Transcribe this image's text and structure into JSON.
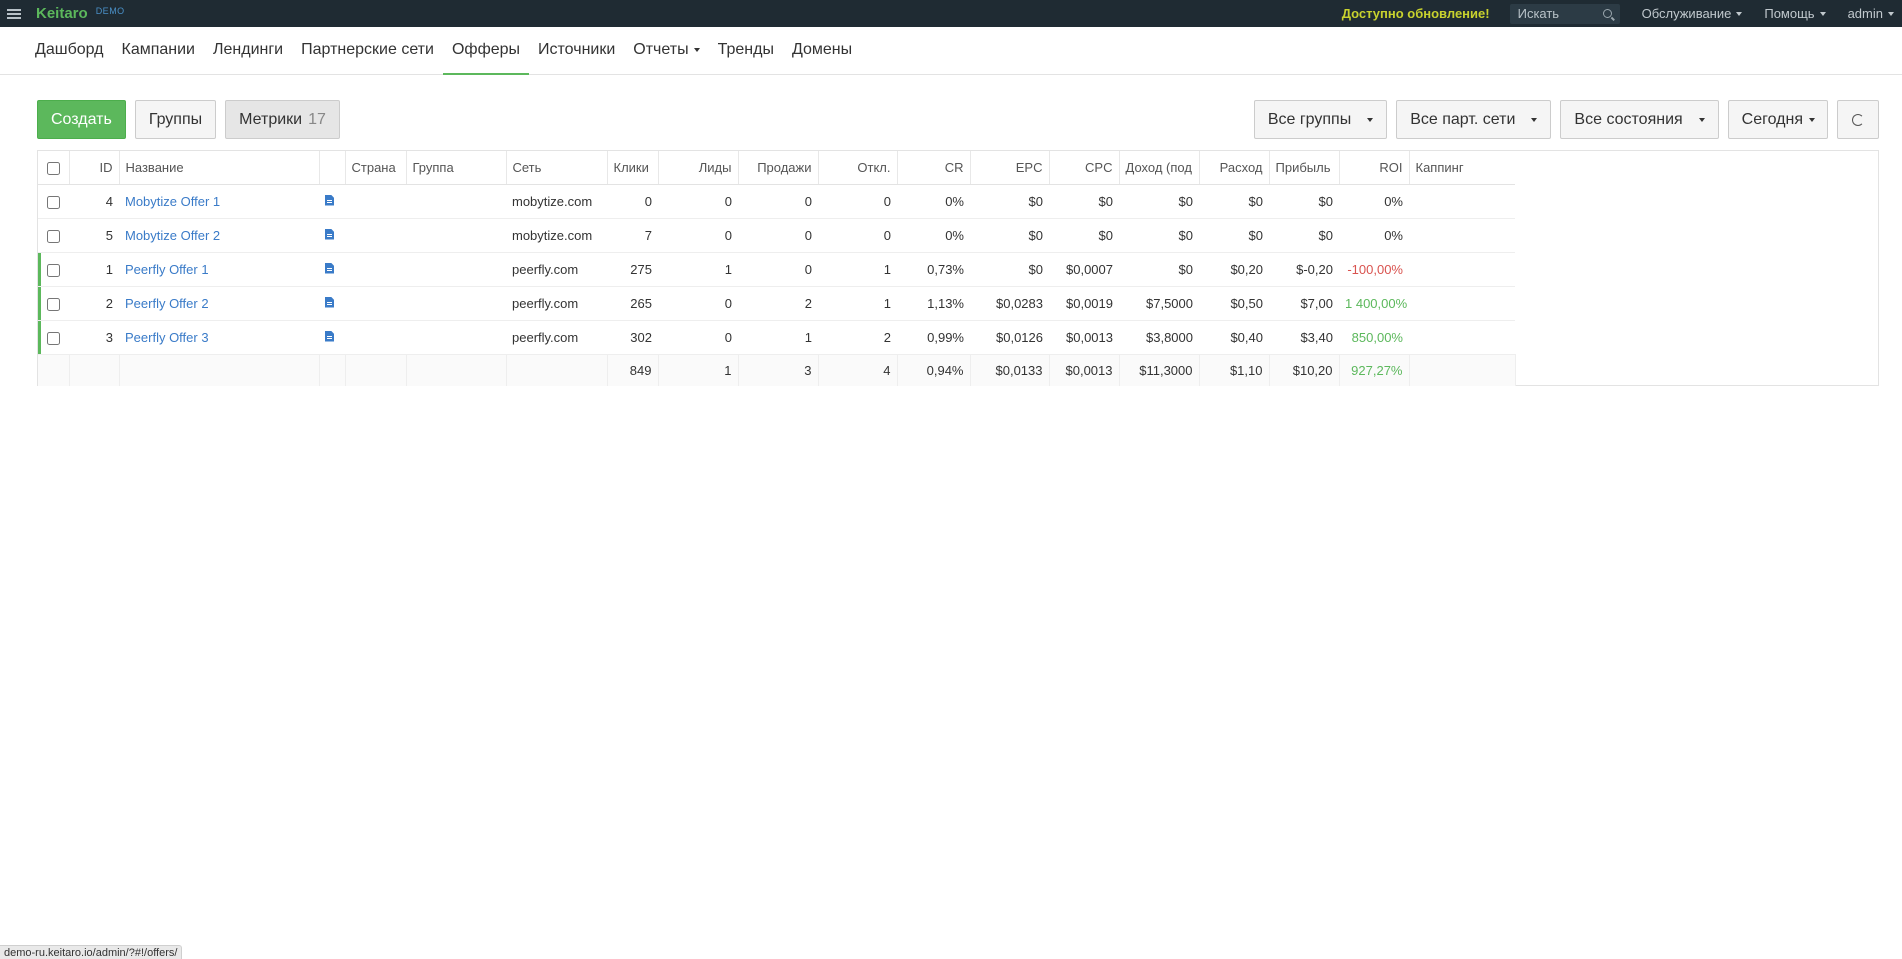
{
  "app": {
    "brand": "Keitaro",
    "brand_sub": "DEMO"
  },
  "topbar": {
    "update_notice": "Доступно обновление!",
    "search_placeholder": "Искать",
    "menus": [
      "Обслуживание",
      "Помощь",
      "admin"
    ]
  },
  "nav": {
    "items": [
      {
        "label": "Дашборд",
        "active": false
      },
      {
        "label": "Кампании",
        "active": false
      },
      {
        "label": "Лендинги",
        "active": false
      },
      {
        "label": "Партнерские сети",
        "active": false
      },
      {
        "label": "Офферы",
        "active": true
      },
      {
        "label": "Источники",
        "active": false
      },
      {
        "label": "Отчеты",
        "active": false,
        "dropdown": true
      },
      {
        "label": "Тренды",
        "active": false
      },
      {
        "label": "Домены",
        "active": false
      }
    ]
  },
  "toolbar": {
    "create": "Создать",
    "groups": "Группы",
    "metrics": "Метрики",
    "metrics_count": "17",
    "filter_groups": "Все группы",
    "filter_networks": "Все парт. сети",
    "filter_states": "Все состояния",
    "filter_period": "Сегодня"
  },
  "table": {
    "columns": [
      "ID",
      "Название",
      "",
      "Страна",
      "Группа",
      "Сеть",
      "Клики",
      "Лиды",
      "Продажи",
      "Откл.",
      "CR",
      "EPC",
      "CPC",
      "Доход (под",
      "Расход",
      "Прибыль",
      "ROI",
      "Каппинг"
    ],
    "rows": [
      {
        "id": "4",
        "name": "Mobytize Offer 1",
        "country": "",
        "group": "",
        "network": "mobytize.com",
        "clicks": "0",
        "leads": "0",
        "sales": "0",
        "rejected": "0",
        "cr": "0%",
        "epc": "$0",
        "cpc": "$0",
        "revenue": "$0",
        "cost": "$0",
        "profit": "$0",
        "roi": "0%",
        "roi_class": "",
        "capping": "",
        "active": false
      },
      {
        "id": "5",
        "name": "Mobytize Offer 2",
        "country": "",
        "group": "",
        "network": "mobytize.com",
        "clicks": "7",
        "leads": "0",
        "sales": "0",
        "rejected": "0",
        "cr": "0%",
        "epc": "$0",
        "cpc": "$0",
        "revenue": "$0",
        "cost": "$0",
        "profit": "$0",
        "roi": "0%",
        "roi_class": "",
        "capping": "",
        "active": false
      },
      {
        "id": "1",
        "name": "Peerfly Offer 1",
        "country": "",
        "group": "",
        "network": "peerfly.com",
        "clicks": "275",
        "leads": "1",
        "sales": "0",
        "rejected": "1",
        "cr": "0,73%",
        "epc": "$0",
        "cpc": "$0,0007",
        "revenue": "$0",
        "cost": "$0,20",
        "profit": "$-0,20",
        "roi": "-100,00%",
        "roi_class": "neg",
        "capping": "",
        "active": true
      },
      {
        "id": "2",
        "name": "Peerfly Offer 2",
        "country": "",
        "group": "",
        "network": "peerfly.com",
        "clicks": "265",
        "leads": "0",
        "sales": "2",
        "rejected": "1",
        "cr": "1,13%",
        "epc": "$0,0283",
        "cpc": "$0,0019",
        "revenue": "$7,5000",
        "cost": "$0,50",
        "profit": "$7,00",
        "roi": "1 400,00%",
        "roi_class": "pos",
        "capping": "",
        "active": true
      },
      {
        "id": "3",
        "name": "Peerfly Offer 3",
        "country": "",
        "group": "",
        "network": "peerfly.com",
        "clicks": "302",
        "leads": "0",
        "sales": "1",
        "rejected": "2",
        "cr": "0,99%",
        "epc": "$0,0126",
        "cpc": "$0,0013",
        "revenue": "$3,8000",
        "cost": "$0,40",
        "profit": "$3,40",
        "roi": "850,00%",
        "roi_class": "pos",
        "capping": "",
        "active": true
      }
    ],
    "totals": {
      "clicks": "849",
      "leads": "1",
      "sales": "3",
      "rejected": "4",
      "cr": "0,94%",
      "epc": "$0,0133",
      "cpc": "$0,0013",
      "revenue": "$11,3000",
      "cost": "$1,10",
      "profit": "$10,20",
      "roi": "927,27%"
    }
  },
  "statusbar": {
    "url": "demo-ru.keitaro.io/admin/?#!/offers/"
  },
  "colors": {
    "topbar": "#1f2b33",
    "brand": "#5cb85c",
    "link": "#3a7bc8",
    "positive": "#5cb85c",
    "negative": "#d9534f",
    "update": "#c8d22e"
  }
}
